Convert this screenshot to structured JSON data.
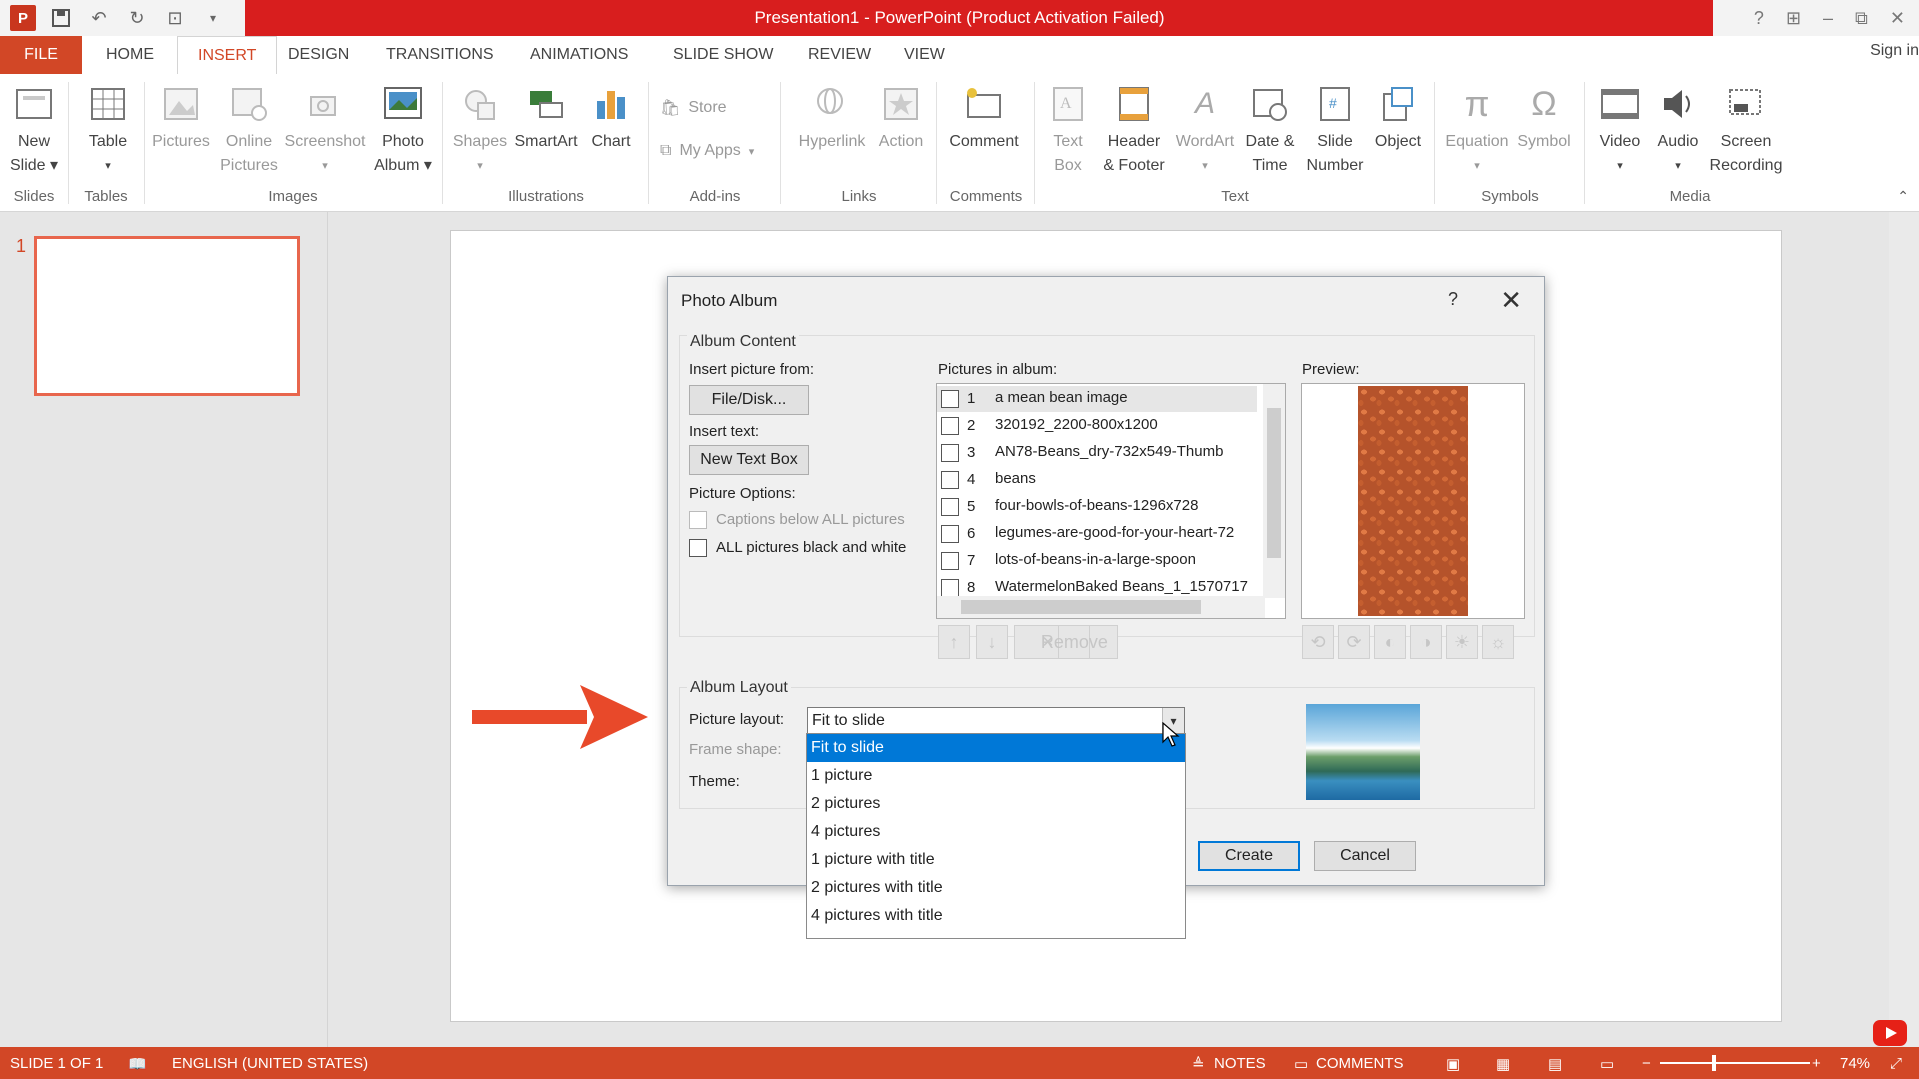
{
  "window": {
    "title": "Presentation1 - PowerPoint (Product Activation Failed)",
    "sign_in": "Sign in",
    "win_help": "?",
    "win_ribbon_opts": "⊞",
    "win_minimize": "–",
    "win_restore": "⧉",
    "win_close": "✕"
  },
  "tabs": [
    "FILE",
    "HOME",
    "INSERT",
    "DESIGN",
    "TRANSITIONS",
    "ANIMATIONS",
    "SLIDE SHOW",
    "REVIEW",
    "VIEW"
  ],
  "ribbon": {
    "new_slide": [
      "New",
      "Slide ▾"
    ],
    "table": [
      "Table",
      "▾"
    ],
    "pictures": "Pictures",
    "online_pictures": [
      "Online",
      "Pictures"
    ],
    "screenshot": [
      "Screenshot",
      "▾"
    ],
    "photo_album": [
      "Photo",
      "Album ▾"
    ],
    "shapes": [
      "Shapes",
      "▾"
    ],
    "smartart": "SmartArt",
    "chart": "Chart",
    "store": "Store",
    "my_apps": "My Apps",
    "hyperlink": "Hyperlink",
    "action": "Action",
    "comment": "Comment",
    "text_box": [
      "Text",
      "Box"
    ],
    "header_footer": [
      "Header",
      "& Footer"
    ],
    "wordart": [
      "WordArt",
      "▾"
    ],
    "date_time": [
      "Date &",
      "Time"
    ],
    "slide_number": [
      "Slide",
      "Number"
    ],
    "object": "Object",
    "equation": [
      "Equation",
      "▾"
    ],
    "symbol": "Symbol",
    "video": [
      "Video",
      "▾"
    ],
    "audio": [
      "Audio",
      "▾"
    ],
    "screen_recording": [
      "Screen",
      "Recording"
    ],
    "groups": {
      "slides": "Slides",
      "tables": "Tables",
      "images": "Images",
      "illustrations": "Illustrations",
      "addins": "Add-ins",
      "links": "Links",
      "comments": "Comments",
      "text": "Text",
      "symbols": "Symbols",
      "media": "Media"
    }
  },
  "thumbnail": {
    "number": "1"
  },
  "dialog": {
    "title": "Photo Album",
    "help": "?",
    "close": "✕",
    "album_content": "Album Content",
    "insert_picture_from": "Insert picture from:",
    "file_disk": "File/Disk...",
    "insert_text": "Insert text:",
    "new_text_box": "New Text Box",
    "picture_options": "Picture Options:",
    "captions_below": "Captions below ALL pictures",
    "black_and_white": "ALL pictures black and white",
    "pictures_in_album": "Pictures in album:",
    "pictures": [
      {
        "num": "1",
        "name": "a mean bean image"
      },
      {
        "num": "2",
        "name": "320192_2200-800x1200"
      },
      {
        "num": "3",
        "name": "AN78-Beans_dry-732x549-Thumb"
      },
      {
        "num": "4",
        "name": "beans"
      },
      {
        "num": "5",
        "name": "four-bowls-of-beans-1296x728"
      },
      {
        "num": "6",
        "name": "legumes-are-good-for-your-heart-72"
      },
      {
        "num": "7",
        "name": "lots-of-beans-in-a-large-spoon"
      },
      {
        "num": "8",
        "name": "WatermelonBaked Beans_1_1570717"
      }
    ],
    "preview": "Preview:",
    "remove": "Remove",
    "album_layout": "Album Layout",
    "picture_layout": "Picture layout:",
    "picture_layout_value": "Fit to slide",
    "frame_shape": "Frame shape:",
    "theme": "Theme:",
    "layout_options": [
      "Fit to slide",
      "1 picture",
      "2 pictures",
      "4 pictures",
      "1 picture with title",
      "2 pictures with title",
      "4 pictures with title"
    ],
    "create": "Create",
    "cancel": "Cancel"
  },
  "status": {
    "slide": "SLIDE 1 OF 1",
    "language": "ENGLISH (UNITED STATES)",
    "notes": "NOTES",
    "comments": "COMMENTS",
    "zoom": "74%"
  },
  "colors": {
    "accent": "#d24726",
    "titlebar_red": "#d81e1e",
    "selection_blue": "#0078d7",
    "arrow": "#e8492a"
  }
}
